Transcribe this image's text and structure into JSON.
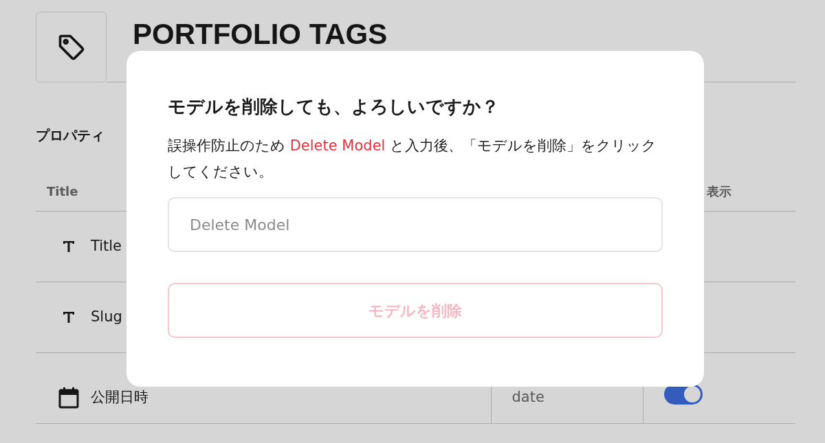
{
  "page": {
    "title": "PORTFOLIO TAGS",
    "section_title": "プロパティ",
    "table": {
      "columns": [
        "Title",
        "表示"
      ],
      "rows": [
        {
          "kind": "text",
          "label": "Title"
        },
        {
          "kind": "text",
          "label": "Slug"
        },
        {
          "kind": "date",
          "label": "公開日時",
          "type": "date",
          "visible": true
        }
      ]
    }
  },
  "dialog": {
    "title": "モデルを削除しても、よろしいですか？",
    "message_before": "誤操作防止のため",
    "keyword": "Delete Model",
    "message_after": "と入力後、「モデルを削除」をクリックしてください。",
    "input": {
      "placeholder": "Delete Model"
    },
    "button": {
      "label": "モデルを削除",
      "disabled": true
    }
  }
}
